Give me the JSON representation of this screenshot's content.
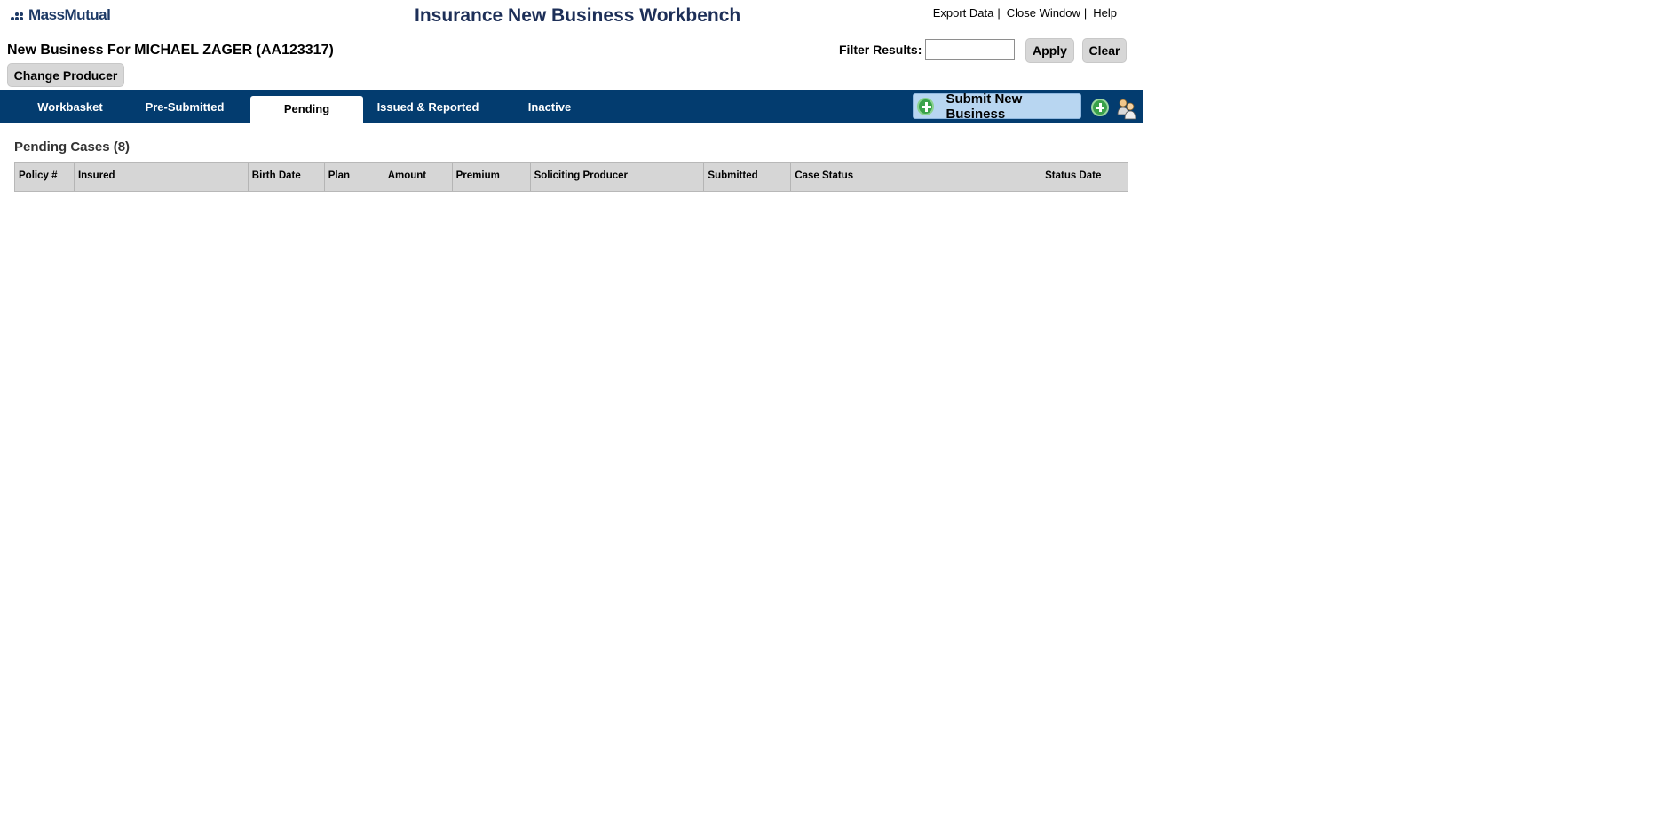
{
  "header": {
    "logo_text": "MassMutual",
    "app_title": "Insurance New Business Workbench",
    "links": [
      "Export Data",
      "Close Window",
      "Help"
    ],
    "separator": "|"
  },
  "page": {
    "title": "New Business For MICHAEL ZAGER (AA123317)",
    "change_producer_label": "Change Producer"
  },
  "filter": {
    "label": "Filter Results:",
    "value": "",
    "apply_label": "Apply",
    "clear_label": "Clear"
  },
  "nav": {
    "tabs": [
      {
        "label": "Workbasket"
      },
      {
        "label": "Pre-Submitted"
      },
      {
        "label": "Pending",
        "active": true
      },
      {
        "label": "Issued & Reported"
      },
      {
        "label": "Inactive"
      }
    ],
    "submit_label": "Submit New Business",
    "accent_color": "#033c6f"
  },
  "section": {
    "title": "Pending Cases (8)"
  },
  "table": {
    "columns": [
      "Policy #",
      "Insured",
      "Birth Date",
      "Plan",
      "Amount",
      "Premium",
      "Soliciting Producer",
      "Submitted",
      "Case Status",
      "Status Date"
    ],
    "rows": []
  },
  "icons": {
    "logo": "massmutual-dots-icon",
    "submit": "add-circle-icon",
    "add": "add-circle-icon",
    "people": "people-icon"
  }
}
